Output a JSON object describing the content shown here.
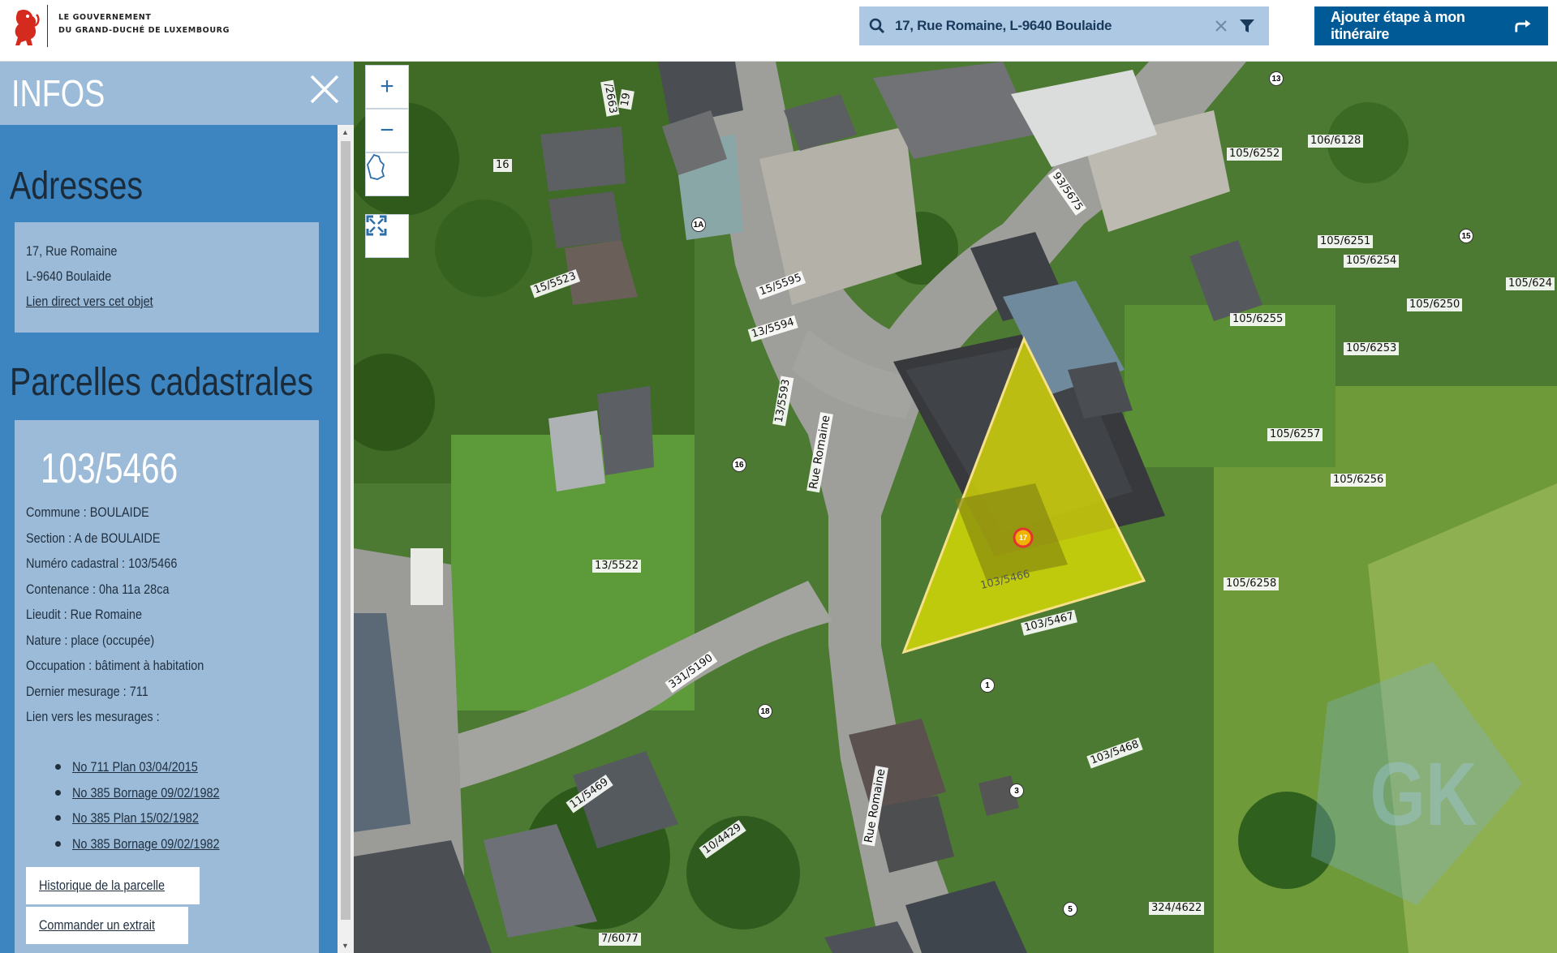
{
  "header": {
    "gov_line1": "LE GOUVERNEMENT",
    "gov_line2": "DU GRAND-DUCHÉ DE LUXEMBOURG",
    "search_value": "17, Rue Romaine, L-9640 Boulaide",
    "itinerary_label": "Ajouter étape à mon itinéraire",
    "icons": [
      "lion-logo-icon",
      "search-icon",
      "clear-icon",
      "filter-icon",
      "route-arrow-icon"
    ]
  },
  "sidebar": {
    "title": "INFOS",
    "addresses_title": "Adresses",
    "address": {
      "line1": "17, Rue Romaine",
      "line2": "L-9640 Boulaide",
      "link": "Lien direct vers cet objet"
    },
    "parcels_title": "Parcelles cadastrales",
    "parcel": {
      "number": "103/5466",
      "lines": [
        "Commune : BOULAIDE",
        "Section : A de BOULAIDE",
        "Numéro cadastral : 103/5466",
        "Contenance : 0ha 11a 28ca",
        "Lieudit : Rue Romaine",
        "Nature : place (occupée)",
        "Occupation : bâtiment à habitation",
        "Dernier mesurage : 711",
        "Lien vers les mesurages :"
      ],
      "measures": [
        "No 711 Plan 03/04/2015",
        "No 385 Bornage 09/02/1982",
        "No 385 Plan 15/02/1982",
        "No 385 Bornage 09/02/1982"
      ],
      "history_button": "Historique de la parcelle",
      "extract_button": "Commander un extrait"
    }
  },
  "map": {
    "controls": [
      "zoom-in",
      "zoom-out",
      "country-outline",
      "fullscreen"
    ],
    "zoom_in": "+",
    "zoom_out": "−",
    "highlight_color": "#e6e600",
    "parcel_labels": [
      "15/5523",
      "15/5595",
      "13/5594",
      "13/5593",
      "13/5522",
      "331/5190",
      "11/5469",
      "10/4429",
      "7/6077",
      "103/5466",
      "103/5467",
      "103/5468",
      "324/4622",
      "93/5675",
      "105/6252",
      "106/6128",
      "105/6251",
      "105/6254",
      "105/6250",
      "105/6255",
      "105/6253",
      "105/6257",
      "105/6256",
      "105/6258",
      "105/624",
      "16",
      "19",
      "/2663"
    ],
    "road_labels": [
      "Rue Romaine",
      "Rue Romaine"
    ],
    "house_numbers": [
      "13",
      "15",
      "1A",
      "16",
      "17",
      "18",
      "1",
      "3",
      "5"
    ],
    "watermark": "GK"
  }
}
